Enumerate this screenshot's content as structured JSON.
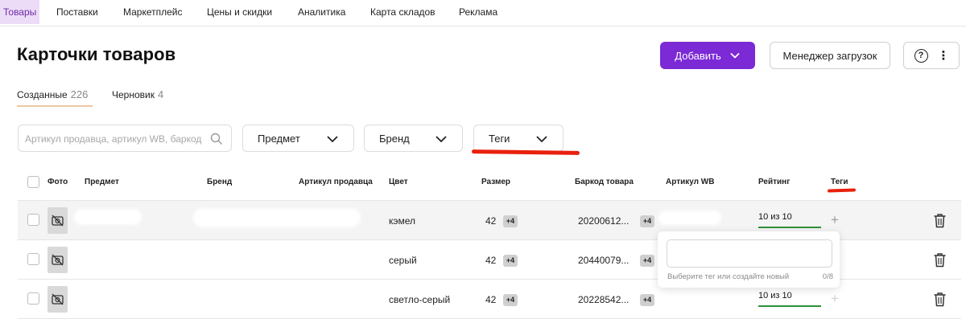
{
  "nav": {
    "tabs": [
      {
        "label": "Товары",
        "active": true
      },
      {
        "label": "Поставки"
      },
      {
        "label": "Маркетплейс"
      },
      {
        "label": "Цены и скидки"
      },
      {
        "label": "Аналитика"
      },
      {
        "label": "Карта складов"
      },
      {
        "label": "Реклама"
      }
    ]
  },
  "header": {
    "title": "Карточки товаров",
    "add_label": "Добавить",
    "upload_manager_label": "Менеджер загрузок",
    "help_glyph": "?",
    "more_glyph": "⋮"
  },
  "subtabs": [
    {
      "label": "Созданные",
      "count": "226",
      "active": true
    },
    {
      "label": "Черновик",
      "count": "4"
    }
  ],
  "filters": {
    "search_placeholder": "Артикул продавца, артикул WB, баркод",
    "subject": "Предмет",
    "brand": "Бренд",
    "tags": "Теги"
  },
  "table": {
    "columns": [
      "Фото",
      "Предмет",
      "Бренд",
      "Артикул продавца",
      "Цвет",
      "Размер",
      "Баркод товара",
      "Артикул WB",
      "Рейтинг",
      "Теги"
    ],
    "rows": [
      {
        "color": "кэмел",
        "size": "42",
        "size_extra": "+4",
        "barcode": "20200612...",
        "barcode_extra": "+4",
        "rating": "10 из 10",
        "rating_value": 10,
        "rating_max": 10
      },
      {
        "color": "серый",
        "size": "42",
        "size_extra": "+4",
        "barcode": "20440079...",
        "barcode_extra": "+4",
        "rating": "",
        "rating_value": null,
        "rating_max": 10
      },
      {
        "color": "светло-серый",
        "size": "42",
        "size_extra": "+4",
        "barcode": "20228542...",
        "barcode_extra": "+4",
        "rating": "10 из 10",
        "rating_value": 10,
        "rating_max": 10
      }
    ],
    "add_tag_glyph": "+"
  },
  "tag_popover": {
    "hint": "Выберите тег или создайте новый",
    "counter": "0/8"
  },
  "colors": {
    "accent": "#7b2ad6",
    "active_tab_bg": "#ecdcf7",
    "annotation": "#e8210e",
    "rating_bar": "#2f8f3a"
  }
}
